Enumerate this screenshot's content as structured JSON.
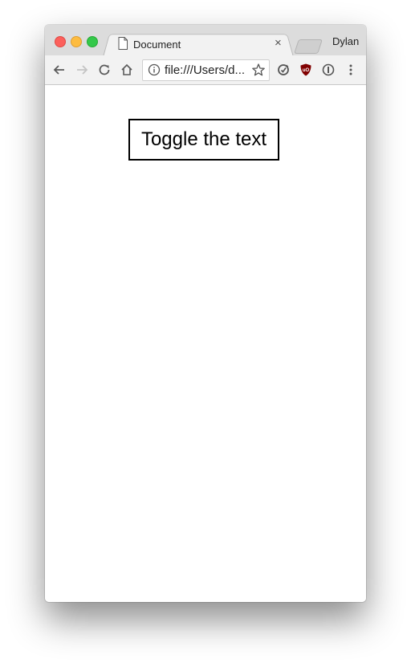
{
  "tab": {
    "title": "Document",
    "close_glyph": "×",
    "icon": "document-icon"
  },
  "profile": {
    "name": "Dylan"
  },
  "toolbar": {
    "back_icon": "back-arrow-icon",
    "forward_icon": "forward-arrow-icon",
    "reload_icon": "reload-icon",
    "home_icon": "home-icon",
    "url": "file:///Users/d...",
    "info_icon": "info-icon",
    "bookmark_icon": "star-icon",
    "extensions": [
      "sync-extension-icon",
      "ublock-icon",
      "onepassword-icon"
    ],
    "menu_icon": "kebab-menu-icon"
  },
  "page": {
    "button_label": "Toggle the text"
  },
  "colors": {
    "close": "#fc605c",
    "minimize": "#fdbc40",
    "zoom": "#34c84a",
    "ublock": "#800000"
  }
}
